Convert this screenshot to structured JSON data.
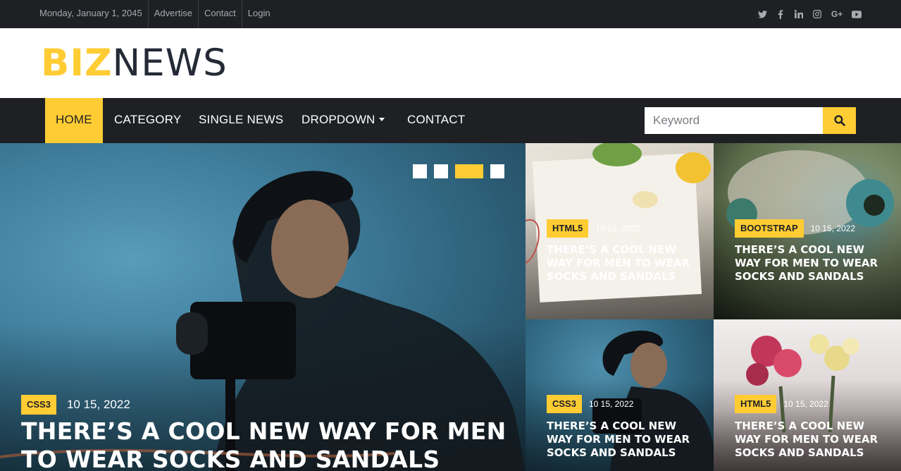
{
  "topbar": {
    "date": "Monday, January 1, 2045",
    "links": [
      "Advertise",
      "Contact",
      "Login"
    ],
    "social_icons": [
      "twitter-icon",
      "facebook-icon",
      "linkedin-icon",
      "instagram-icon",
      "google-plus-icon",
      "youtube-icon"
    ]
  },
  "header": {
    "logo_bold": "BIZ",
    "logo_light": "NEWS"
  },
  "nav": {
    "items": [
      "HOME",
      "CATEGORY",
      "SINGLE NEWS",
      "DROPDOWN",
      "CONTACT"
    ],
    "active": "HOME",
    "search_placeholder": "Keyword"
  },
  "hero": {
    "tag": "CSS3",
    "date": "10 15, 2022",
    "title": "THERE’S A COOL NEW WAY FOR MEN TO WEAR SOCKS AND SANDALS",
    "slide_count": 4,
    "active_slide": 3
  },
  "cards": [
    {
      "tag": "HTML5",
      "date": "10 15, 2022",
      "title": "THERE’S A COOL NEW WAY FOR MEN TO WEAR SOCKS AND SANDALS"
    },
    {
      "tag": "BOOTSTRAP",
      "date": "10 15, 2022",
      "title": "THERE’S A COOL NEW WAY FOR MEN TO WEAR SOCKS AND SANDALS"
    },
    {
      "tag": "CSS3",
      "date": "10 15, 2022",
      "title": "THERE’S A COOL NEW WAY FOR MEN TO WEAR SOCKS AND SANDALS"
    },
    {
      "tag": "HTML5",
      "date": "10 15, 2022",
      "title": "THERE’S A COOL NEW WAY FOR MEN TO WEAR SOCKS AND SANDALS"
    }
  ],
  "colors": {
    "accent": "#ffcc33",
    "dark": "#1e2024",
    "logo_text": "#252a36"
  }
}
